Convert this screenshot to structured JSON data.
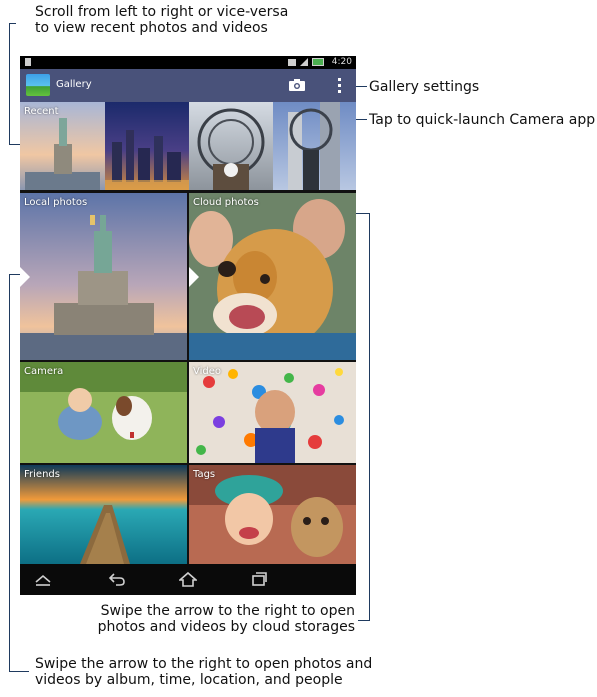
{
  "callouts": {
    "scroll": {
      "line1": "Scroll from left to right or vice-versa",
      "line2": "to view recent photos and videos"
    },
    "gallery_settings": "Gallery settings",
    "camera": "Tap to quick-launch Camera app",
    "cloud": {
      "line1": "Swipe the arrow to the right to open",
      "line2": "photos and videos by cloud storages"
    },
    "local": {
      "line1": "Swipe the arrow to the right to open photos and",
      "line2": "videos by album, time, location, and people"
    }
  },
  "phone": {
    "status": {
      "time": "4:20"
    },
    "action_bar": {
      "title": "Gallery"
    },
    "tiles": {
      "recent": "Recent",
      "local_photos": "Local photos",
      "cloud_photos": "Cloud photos",
      "camera": "Camera",
      "video": "Video",
      "friends": "Friends",
      "tags": "Tags"
    },
    "icons": {
      "app": "gallery-app-icon",
      "camera": "camera-icon",
      "menu": "overflow-menu-icon",
      "home": "home-icon",
      "back": "back-icon",
      "recents": "recent-apps-icon",
      "hide": "hide-bar-icon"
    }
  }
}
